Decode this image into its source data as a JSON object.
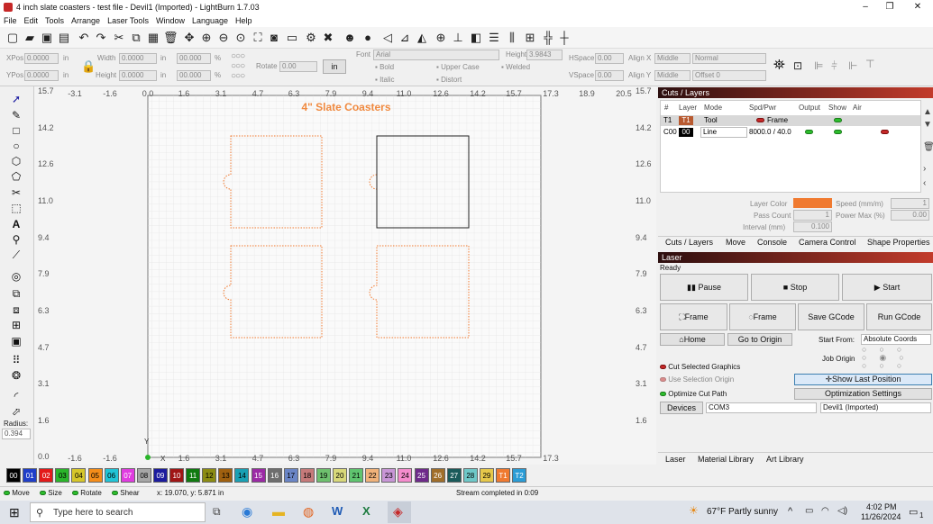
{
  "window": {
    "title": "4 inch slate coasters - test file - Devil1 (Imported) - LightBurn 1.7.03",
    "controls": [
      "–",
      "❐",
      "✕"
    ]
  },
  "menu": [
    "File",
    "Edit",
    "Tools",
    "Arrange",
    "Laser Tools",
    "Window",
    "Language",
    "Help"
  ],
  "toolbar_icons": [
    "new-file-icon",
    "open-file-icon",
    "save-icon",
    "save-as-icon",
    "print-icon",
    "undo-icon",
    "redo-icon",
    "cut-icon",
    "copy-icon",
    "paste-icon",
    "delete-icon",
    "move-icon",
    "zoom-in-icon",
    "zoom-out-icon",
    "zoom-fit-icon",
    "zoom-frame-icon",
    "camera-icon",
    "monitor-icon",
    "settings-icon",
    "machine-settings-icon",
    "group-icon",
    "user-icon",
    "align-icon",
    "mirror-icon",
    "flip-icon",
    "origin-icon",
    "distribute-icon",
    "dock-icon",
    "center-icon",
    "crosshair-icon"
  ],
  "props": {
    "xpos_label": "XPos",
    "xpos": "0.0000",
    "ypos_label": "YPos",
    "ypos": "0.0000",
    "unit": "in",
    "width_label": "Width",
    "width": "0.0000",
    "height_label": "Height",
    "height": "0.0000",
    "pct_w": "00.000",
    "pct_h": "00.000",
    "pct": "%",
    "rotate_label": "Rotate",
    "rotate": "0.00",
    "unit_btn": "in",
    "font_label": "Font",
    "font": "Arial",
    "font_height_label": "Height",
    "font_height": "3.9843",
    "bold": "Bold",
    "italic": "Italic",
    "upper": "Upper Case",
    "distort": "Distort",
    "welded": "Welded",
    "hspace_label": "HSpace",
    "hspace": "0.00",
    "vspace_label": "VSpace",
    "vspace": "0.00",
    "alignx_label": "Align X",
    "alignx": "Middle",
    "aligny_label": "Align Y",
    "aligny": "Middle",
    "normal": "Normal",
    "offset": "Offset 0"
  },
  "canvas": {
    "title": "4\" Slate Coasters",
    "top_ticks": [
      "-3.1",
      "-1.6",
      "0.0",
      "1.6",
      "3.1",
      "4.7",
      "6.3",
      "7.9",
      "9.4",
      "11.0",
      "12.6",
      "14.2",
      "15.7",
      "17.3",
      "18.9",
      "20.5"
    ],
    "left_ticks": [
      "15.7",
      "14.2",
      "12.6",
      "11.0",
      "9.4",
      "7.9",
      "6.3",
      "4.7",
      "3.1",
      "1.6",
      "0.0"
    ],
    "right_ticks": [
      "15.7",
      "14.2",
      "12.6",
      "11.0",
      "9.4",
      "7.9",
      "6.3",
      "4.7",
      "3.1",
      "1.6"
    ],
    "axis_y": "Y",
    "axis_x": "X"
  },
  "palette": [
    {
      "label": "00",
      "color": "#000000",
      "fg": "#ffffff"
    },
    {
      "label": "01",
      "color": "#1f3ec9",
      "fg": "#ffffff"
    },
    {
      "label": "02",
      "color": "#e31a1a",
      "fg": "#ffffff"
    },
    {
      "label": "03",
      "color": "#2ab52a",
      "fg": "#000000"
    },
    {
      "label": "04",
      "color": "#d6c62a",
      "fg": "#000000"
    },
    {
      "label": "05",
      "color": "#f58d1a",
      "fg": "#000000"
    },
    {
      "label": "06",
      "color": "#21c4d6",
      "fg": "#000000"
    },
    {
      "label": "07",
      "color": "#e03ce0",
      "fg": "#ffffff"
    },
    {
      "label": "08",
      "color": "#a6a6a6",
      "fg": "#000000"
    },
    {
      "label": "09",
      "color": "#1b1b9e",
      "fg": "#ffffff"
    },
    {
      "label": "10",
      "color": "#a01515",
      "fg": "#ffffff"
    },
    {
      "label": "11",
      "color": "#0f7a0f",
      "fg": "#ffffff"
    },
    {
      "label": "12",
      "color": "#8b8b12",
      "fg": "#000000"
    },
    {
      "label": "13",
      "color": "#a0600f",
      "fg": "#000000"
    },
    {
      "label": "14",
      "color": "#19a0b4",
      "fg": "#000000"
    },
    {
      "label": "15",
      "color": "#9b2aa5",
      "fg": "#ffffff"
    },
    {
      "label": "16",
      "color": "#6e6e6e",
      "fg": "#ffffff"
    },
    {
      "label": "17",
      "color": "#6a85c6",
      "fg": "#000000"
    },
    {
      "label": "18",
      "color": "#c67a7a",
      "fg": "#000000"
    },
    {
      "label": "19",
      "color": "#6ec06e",
      "fg": "#000000"
    },
    {
      "label": "20",
      "color": "#d8d87a",
      "fg": "#000000"
    },
    {
      "label": "21",
      "color": "#5fc46f",
      "fg": "#000000"
    },
    {
      "label": "22",
      "color": "#f0b27a",
      "fg": "#000000"
    },
    {
      "label": "23",
      "color": "#c896d6",
      "fg": "#000000"
    },
    {
      "label": "24",
      "color": "#f58ccd",
      "fg": "#000000"
    },
    {
      "label": "25",
      "color": "#6e2a8a",
      "fg": "#ffffff"
    },
    {
      "label": "26",
      "color": "#a06e2a",
      "fg": "#ffffff"
    },
    {
      "label": "27",
      "color": "#1a5a5a",
      "fg": "#ffffff"
    },
    {
      "label": "28",
      "color": "#6ec8c8",
      "fg": "#000000"
    },
    {
      "label": "29",
      "color": "#e6c84a",
      "fg": "#000000"
    },
    {
      "label": "T1",
      "color": "#f07a30",
      "fg": "#ffffff"
    },
    {
      "label": "T2",
      "color": "#2a9cd6",
      "fg": "#ffffff"
    }
  ],
  "status": {
    "move": "Move",
    "size": "Size",
    "rotate": "Rotate",
    "shear": "Shear",
    "coords": "x: 19.070, y: 5.871 in",
    "message": "Stream completed in 0:09"
  },
  "cuts": {
    "header": "Cuts / Layers",
    "cols": [
      "#",
      "Layer",
      "Mode",
      "Spd/Pwr",
      "Output",
      "Show",
      "Air"
    ],
    "rows": [
      {
        "num": "T1",
        "layer": "T1",
        "mode": "Tool",
        "spd": "Frame",
        "color": "#f07a30"
      },
      {
        "num": "C00",
        "layer": "00",
        "mode": "Line",
        "spd": "8000.0 / 40.0",
        "color": "#000000"
      }
    ],
    "layer_color_label": "Layer Color",
    "speed_label": "Speed (mm/m)",
    "speed": "1",
    "pass_label": "Pass Count",
    "pass": "1",
    "power_label": "Power Max (%)",
    "power": "0.00",
    "interval_label": "Interval (mm)",
    "interval": "0.100",
    "tabs": [
      "Cuts / Layers",
      "Move",
      "Console",
      "Camera Control",
      "Shape Properties"
    ]
  },
  "laser": {
    "header": "Laser",
    "status": "Ready",
    "pause": "Pause",
    "stop": "Stop",
    "start": "Start",
    "frame1": "Frame",
    "frame2": "Frame",
    "save_gcode": "Save GCode",
    "run_gcode": "Run GCode",
    "home": "Home",
    "go_origin": "Go to Origin",
    "start_from_label": "Start From:",
    "start_from": "Absolute Coords",
    "job_origin": "Job Origin",
    "cut_selected": "Cut Selected Graphics",
    "use_selection": "Use Selection Origin",
    "show_last": "Show Last Position",
    "optimize": "Optimize Cut Path",
    "opt_settings": "Optimization Settings",
    "devices": "Devices",
    "port": "COM3",
    "device": "Devil1 (Imported)",
    "tabs": [
      "Laser",
      "Material Library",
      "Art Library"
    ]
  },
  "left_radius": {
    "label": "Radius:",
    "value": "0.394"
  },
  "taskbar": {
    "search": "Type here to search",
    "weather": "67°F  Partly sunny",
    "time": "4:02 PM",
    "date": "11/26/2024",
    "notif": "1"
  }
}
